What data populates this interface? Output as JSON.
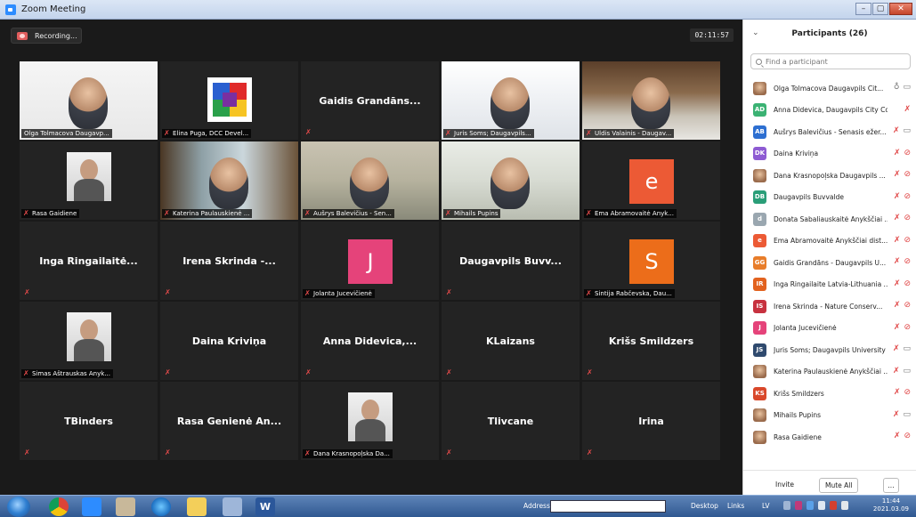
{
  "window": {
    "title": "Zoom Meeting",
    "min": "–",
    "max": "▢",
    "close": "✕"
  },
  "meeting": {
    "recording_label": "Recording...",
    "timer": "02:11:57"
  },
  "tiles": [
    {
      "name": "Olga Tolmacova Daugavp...",
      "kind": "video"
    },
    {
      "name": "Elina Puga, DCC Devel...",
      "kind": "logo"
    },
    {
      "name": "Gaidis Grandāns...",
      "kind": "center"
    },
    {
      "name": "Juris Soms; Daugavpils...",
      "kind": "video"
    },
    {
      "name": "Uldis Valainis - Daugav...",
      "kind": "video"
    },
    {
      "name": "Rasa Gaidiene",
      "kind": "photo"
    },
    {
      "name": "Katerina Paulauskienė ...",
      "kind": "video"
    },
    {
      "name": "Aušrys Balevičius - Sen...",
      "kind": "video"
    },
    {
      "name": "Mihails Pupins",
      "kind": "video"
    },
    {
      "name": "Ema Abramovaitė Anyk...",
      "kind": "avatar",
      "letter": "e"
    },
    {
      "name": "Inga Ringailaitė...",
      "kind": "center"
    },
    {
      "name": "Irena Skrinda -...",
      "kind": "center"
    },
    {
      "name": "Jolanta Jucevičienė",
      "kind": "avatar",
      "letter": "J"
    },
    {
      "name": "Daugavpils Buvv...",
      "kind": "center"
    },
    {
      "name": "Sintija Rabčevska, Dau...",
      "kind": "avatar",
      "letter": "S"
    },
    {
      "name": "Simas Aštrauskas Anyk...",
      "kind": "photo"
    },
    {
      "name": "Daina Kriviņa",
      "kind": "center"
    },
    {
      "name": "Anna Didevica,...",
      "kind": "center"
    },
    {
      "name": "KLaizans",
      "kind": "center"
    },
    {
      "name": "Krišs Smildzers",
      "kind": "center"
    },
    {
      "name": "TBinders",
      "kind": "center"
    },
    {
      "name": "Rasa Genienė An...",
      "kind": "center"
    },
    {
      "name": "Dana Krasnopoļska Da...",
      "kind": "photo"
    },
    {
      "name": "Tlivcane",
      "kind": "center"
    },
    {
      "name": "Irina",
      "kind": "center"
    }
  ],
  "participants_panel": {
    "collapse_icon": "⌄",
    "title": "Participants (26)",
    "search_placeholder": "Find a participant",
    "participants": [
      {
        "initials": "",
        "name": "Olga Tolmacova Daugavpils Cit...",
        "mic": "on",
        "cam": "on"
      },
      {
        "initials": "AD",
        "name": "Anna Didevica, Daugavpils City Cou...",
        "mic": "off",
        "cam": "none"
      },
      {
        "initials": "AB",
        "name": "Aušrys Balevičius - Senasis ežer...",
        "mic": "off",
        "cam": "on"
      },
      {
        "initials": "DK",
        "name": "Daina Kriviņa",
        "mic": "off",
        "cam": "off"
      },
      {
        "initials": "",
        "name": "Dana Krasnopoļska Daugavpils ...",
        "mic": "off",
        "cam": "off"
      },
      {
        "initials": "DB",
        "name": "Daugavpils Buvvalde",
        "mic": "off",
        "cam": "off"
      },
      {
        "initials": "d",
        "name": "Donata Sabaliauskaitė Anykščiai ...",
        "mic": "off",
        "cam": "off"
      },
      {
        "initials": "e",
        "name": "Ema Abramovaitė Anykščiai dist...",
        "mic": "off",
        "cam": "off"
      },
      {
        "initials": "GG",
        "name": "Gaidis Grandāns - Daugavpils U...",
        "mic": "off",
        "cam": "off"
      },
      {
        "initials": "IR",
        "name": "Inga Ringailaite Latvia-Lithuania ...",
        "mic": "off",
        "cam": "off"
      },
      {
        "initials": "IS",
        "name": "Irena Skrinda - Nature Conserv...",
        "mic": "off",
        "cam": "off"
      },
      {
        "initials": "J",
        "name": "Jolanta Jucevičienė",
        "mic": "off",
        "cam": "off"
      },
      {
        "initials": "JS",
        "name": "Juris Soms; Daugavpils University",
        "mic": "off",
        "cam": "on"
      },
      {
        "initials": "",
        "name": "Katerina Paulauskienė Anykščiai ...",
        "mic": "off",
        "cam": "on"
      },
      {
        "initials": "KS",
        "name": "Krišs Smildzers",
        "mic": "off",
        "cam": "off"
      },
      {
        "initials": "",
        "name": "Mihails Pupins",
        "mic": "off",
        "cam": "on"
      },
      {
        "initials": "",
        "name": "Rasa Gaidiene",
        "mic": "off",
        "cam": "off"
      }
    ],
    "invite_label": "Invite",
    "mute_all_label": "Mute All",
    "more_label": "..."
  },
  "avatar_colors": {
    "AD": "#3bb273",
    "AB": "#2d6fd1",
    "DK": "#8e5bd3",
    "DB": "#2a9e78",
    "d": "#9aa7b0",
    "e": "#ec5a35",
    "GG": "#e87d2a",
    "IR": "#e2621f",
    "IS": "#c7323f",
    "J": "#e5437a",
    "JS": "#2f4a6e",
    "KS": "#d9482b"
  },
  "tile_avatar_colors": {
    "e": "#ec5a35",
    "J": "#e5437a",
    "S": "#ec6d1a"
  },
  "taskbar": {
    "address_label": "Address",
    "desktop_label": "Desktop",
    "links_label": "Links",
    "lang": "LV",
    "time": "11:44",
    "date": "2021.03.09",
    "word_label": "W"
  }
}
